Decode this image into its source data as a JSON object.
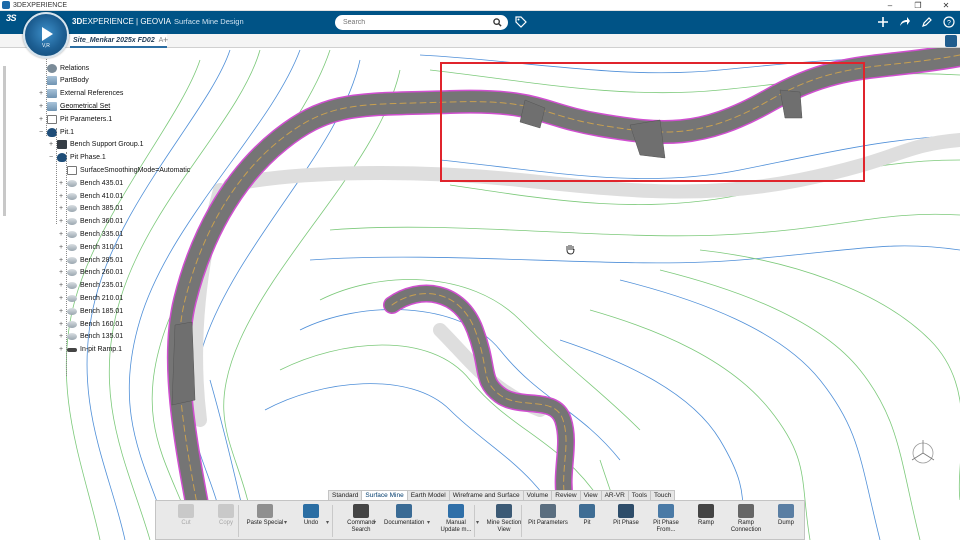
{
  "window": {
    "title": "3DEXPERIENCE",
    "controls": [
      "–",
      "❐",
      "✕"
    ]
  },
  "topbar": {
    "brand_prefix": "3D",
    "brand_main": "EXPERIENCE | GEOVIA",
    "app_name": "Surface Mine Design",
    "search_placeholder": "Search",
    "compass_label": "V,R",
    "colors": {
      "bar": "#005386",
      "accent": "#2b6ea3"
    }
  },
  "tabs": {
    "active_doc": "Site_Menkar 2025x FD02",
    "active_doc_suffix": "A",
    "add_label": "+"
  },
  "tree": [
    {
      "label": "Relations",
      "icon": "relations-icon",
      "indent": 1,
      "pm": ""
    },
    {
      "label": "PartBody",
      "icon": "partbody-icon",
      "indent": 1,
      "pm": ""
    },
    {
      "label": "External References",
      "icon": "ext-ref-icon",
      "indent": 1,
      "pm": "+"
    },
    {
      "label": "Geometrical Set",
      "icon": "geoset-icon",
      "indent": 1,
      "pm": "+",
      "underline": true
    },
    {
      "label": "Pit Parameters.1",
      "icon": "pitparam-icon",
      "indent": 1,
      "pm": "+"
    },
    {
      "label": "Pit.1",
      "icon": "pit-icon",
      "indent": 1,
      "pm": "−"
    },
    {
      "label": "Bench Support Group.1",
      "icon": "bench-group-icon",
      "indent": 2,
      "pm": "+"
    },
    {
      "label": "Pit Phase.1",
      "icon": "pit-phase-icon",
      "indent": 2,
      "pm": "−"
    },
    {
      "label": "SurfaceSmoothingMode=Automatic",
      "icon": "param-icon",
      "indent": 3,
      "pm": ""
    },
    {
      "label": "Bench 435.01",
      "icon": "bench-icon",
      "indent": 3,
      "pm": "+"
    },
    {
      "label": "Bench 410.01",
      "icon": "bench-icon",
      "indent": 3,
      "pm": "+"
    },
    {
      "label": "Bench 385.01",
      "icon": "bench-icon",
      "indent": 3,
      "pm": "+"
    },
    {
      "label": "Bench 360.01",
      "icon": "bench-icon",
      "indent": 3,
      "pm": "+"
    },
    {
      "label": "Bench 335.01",
      "icon": "bench-icon",
      "indent": 3,
      "pm": "+"
    },
    {
      "label": "Bench 310.01",
      "icon": "bench-icon",
      "indent": 3,
      "pm": "+"
    },
    {
      "label": "Bench 285.01",
      "icon": "bench-icon",
      "indent": 3,
      "pm": "+"
    },
    {
      "label": "Bench 260.01",
      "icon": "bench-icon",
      "indent": 3,
      "pm": "+"
    },
    {
      "label": "Bench 235.01",
      "icon": "bench-icon",
      "indent": 3,
      "pm": "+"
    },
    {
      "label": "Bench 210.01",
      "icon": "bench-icon",
      "indent": 3,
      "pm": "+"
    },
    {
      "label": "Bench 185.01",
      "icon": "bench-icon",
      "indent": 3,
      "pm": "+"
    },
    {
      "label": "Bench 160.01",
      "icon": "bench-icon",
      "indent": 3,
      "pm": "+"
    },
    {
      "label": "Bench 135.01",
      "icon": "bench-icon",
      "indent": 3,
      "pm": "+"
    },
    {
      "label": "In-pit Ramp.1",
      "icon": "ramp-icon",
      "indent": 3,
      "pm": "+"
    }
  ],
  "action_tabs": [
    "Standard",
    "Surface Mine",
    "Earth Model",
    "Wireframe and Surface",
    "Volume",
    "Review",
    "View",
    "AR-VR",
    "Tools",
    "Touch"
  ],
  "active_action_tab": "Surface Mine",
  "actions": [
    {
      "label": "Cut",
      "icon": "cut-icon",
      "enabled": false
    },
    {
      "label": "Copy",
      "icon": "copy-icon",
      "enabled": false
    },
    {
      "label": "Paste Special",
      "icon": "paste-icon",
      "enabled": true
    },
    {
      "label": "Undo",
      "icon": "undo-icon",
      "enabled": true
    },
    {
      "label": "Command Search",
      "icon": "command-search-icon",
      "enabled": true
    },
    {
      "label": "Documentation",
      "icon": "documentation-icon",
      "enabled": true
    },
    {
      "label": "Manual Update m...",
      "icon": "manual-update-icon",
      "enabled": true
    },
    {
      "label": "Mine Section View",
      "icon": "mine-section-icon",
      "enabled": true
    },
    {
      "label": "Pit Parameters",
      "icon": "pit-parameters-icon",
      "enabled": true
    },
    {
      "label": "Pit",
      "icon": "pit-icon",
      "enabled": true
    },
    {
      "label": "Pit Phase",
      "icon": "pit-phase-icon",
      "enabled": true
    },
    {
      "label": "Pit Phase From...",
      "icon": "pit-phase-from-icon",
      "enabled": true
    },
    {
      "label": "Ramp",
      "icon": "ramp-icon",
      "enabled": true
    },
    {
      "label": "Ramp Connection",
      "icon": "ramp-connection-icon",
      "enabled": true
    },
    {
      "label": "Dump",
      "icon": "dump-icon",
      "enabled": true
    }
  ]
}
